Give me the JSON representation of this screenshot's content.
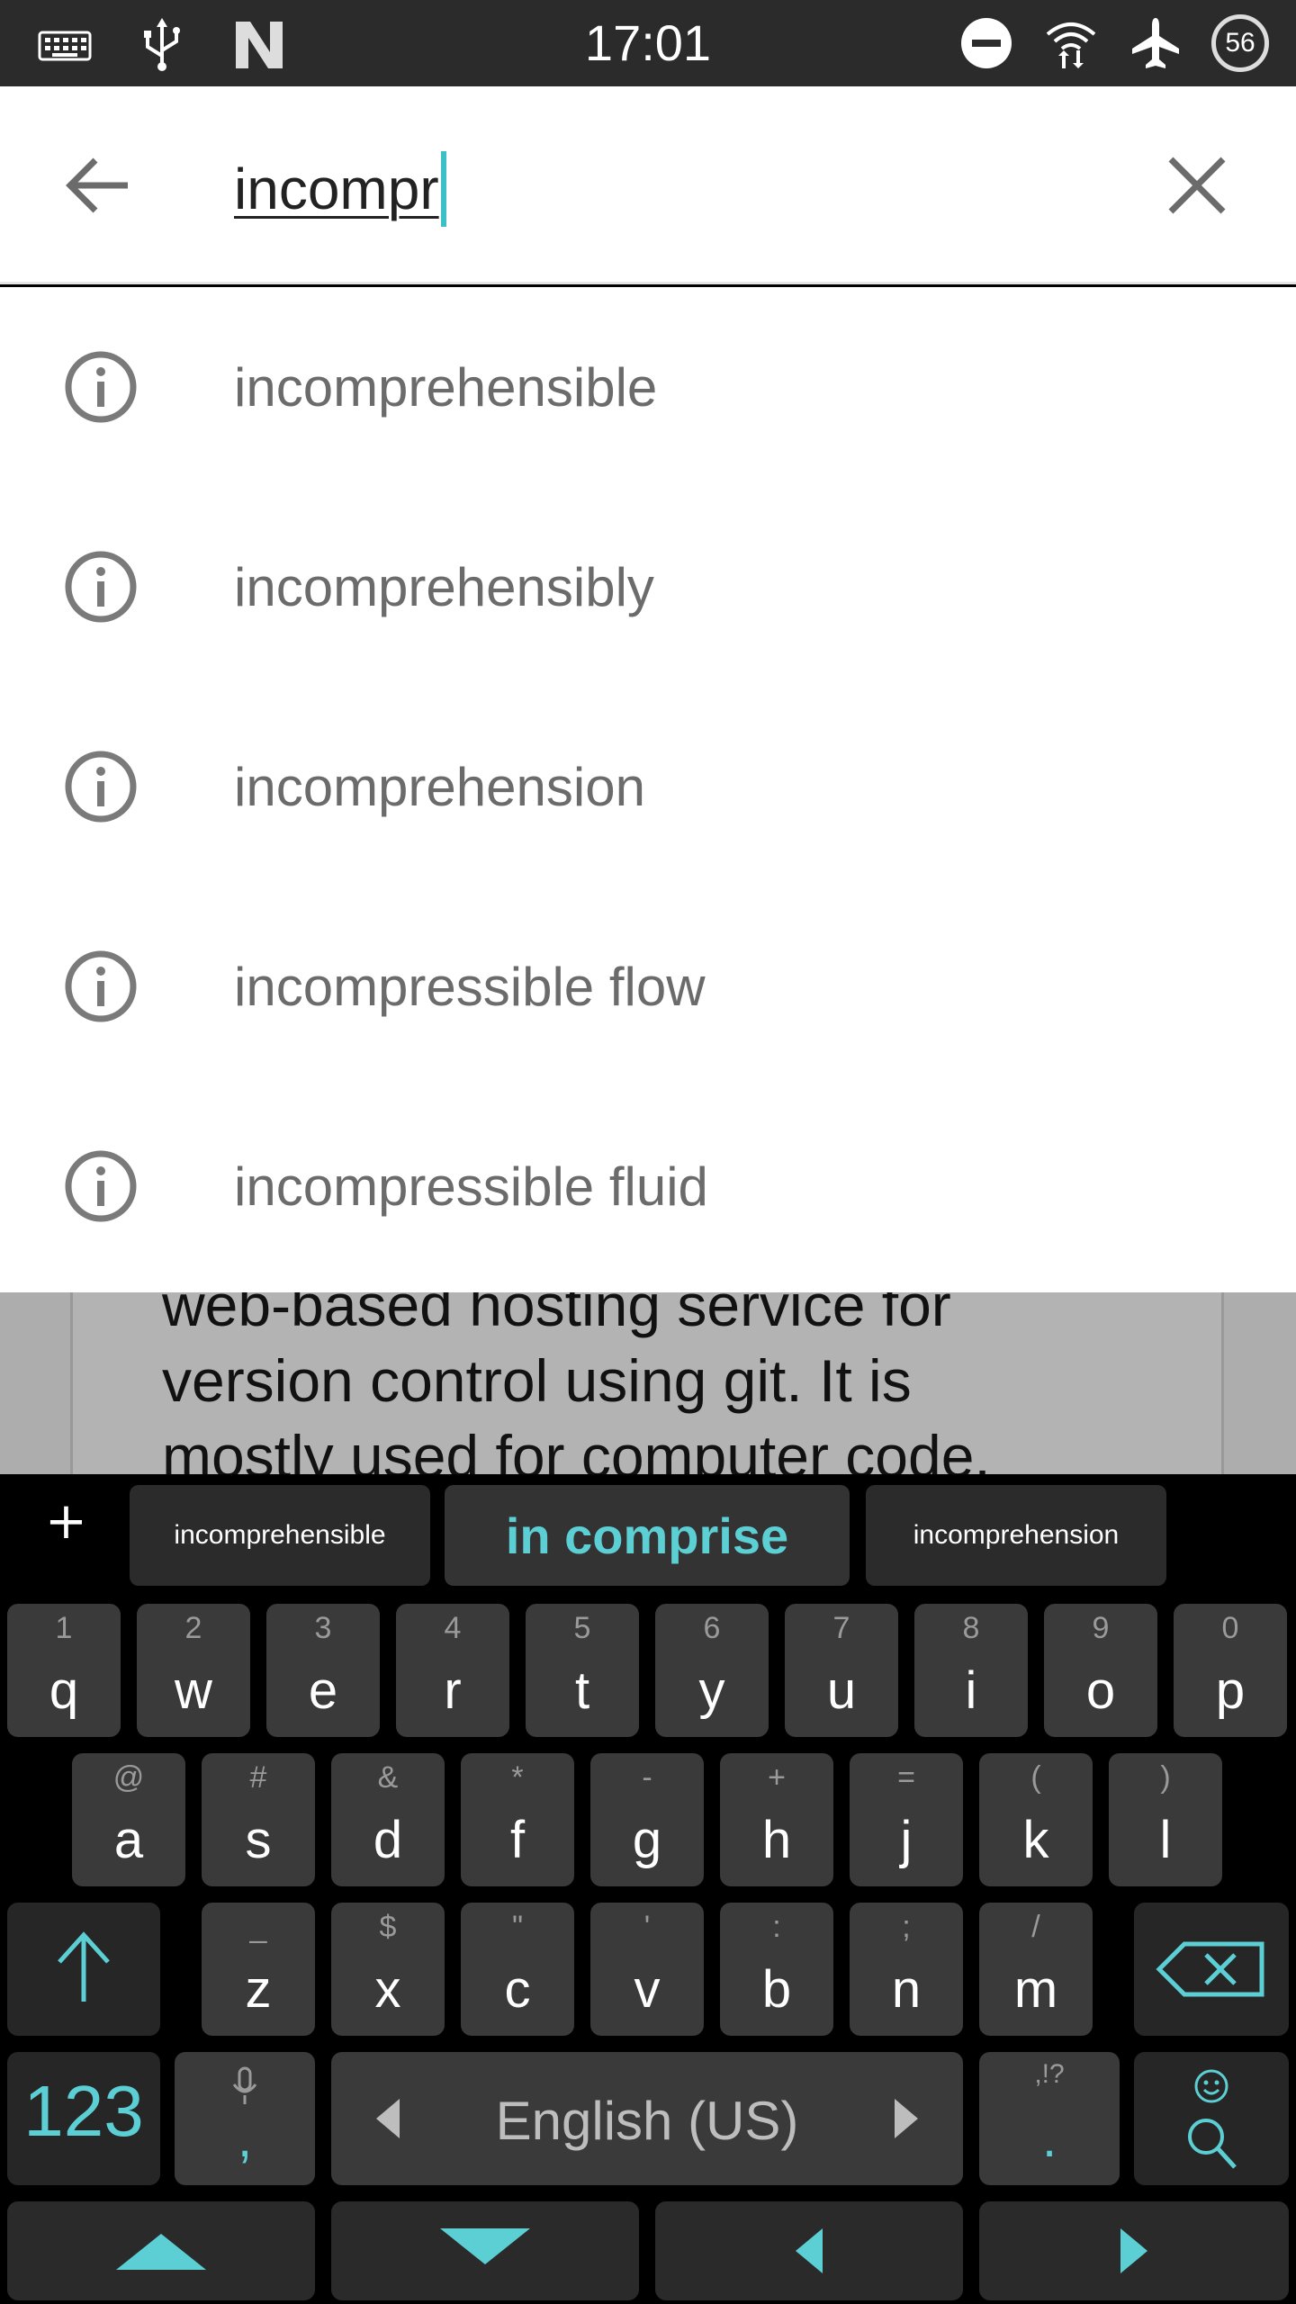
{
  "status_bar": {
    "time": "17:01",
    "battery": "56",
    "left_icons": [
      "keyboard-icon",
      "usb-icon",
      "n-notification-icon"
    ],
    "right_icons": [
      "do-not-disturb-icon",
      "wifi-icon",
      "airplane-mode-icon",
      "battery-icon"
    ]
  },
  "search": {
    "value": "incompr"
  },
  "suggestions": [
    "incomprehensible",
    "incomprehensibly",
    "incomprehension",
    "incompressible flow",
    "incompressible fluid"
  ],
  "background_text": [
    "web-based hosting service for",
    "version control using git. It is",
    "mostly used for computer code."
  ],
  "keyboard": {
    "suggest": {
      "left": "incomprehensible",
      "center": "in comprise",
      "right": "incomprehension",
      "plus": "+"
    },
    "row1": [
      {
        "hint": "1",
        "key": "q"
      },
      {
        "hint": "2",
        "key": "w"
      },
      {
        "hint": "3",
        "key": "e"
      },
      {
        "hint": "4",
        "key": "r"
      },
      {
        "hint": "5",
        "key": "t"
      },
      {
        "hint": "6",
        "key": "y"
      },
      {
        "hint": "7",
        "key": "u"
      },
      {
        "hint": "8",
        "key": "i"
      },
      {
        "hint": "9",
        "key": "o"
      },
      {
        "hint": "0",
        "key": "p"
      }
    ],
    "row2": [
      {
        "hint": "@",
        "key": "a"
      },
      {
        "hint": "#",
        "key": "s"
      },
      {
        "hint": "&",
        "key": "d"
      },
      {
        "hint": "*",
        "key": "f"
      },
      {
        "hint": "-",
        "key": "g"
      },
      {
        "hint": "+",
        "key": "h"
      },
      {
        "hint": "=",
        "key": "j"
      },
      {
        "hint": "(",
        "key": "k"
      },
      {
        "hint": ")",
        "key": "l"
      }
    ],
    "row3": [
      {
        "hint": "_",
        "key": "z"
      },
      {
        "hint": "$",
        "key": "x"
      },
      {
        "hint": "\"",
        "key": "c"
      },
      {
        "hint": "'",
        "key": "v"
      },
      {
        "hint": ":",
        "key": "b"
      },
      {
        "hint": ";",
        "key": "n"
      },
      {
        "hint": "/",
        "key": "m"
      }
    ],
    "num_key": "123",
    "comma_key": ",",
    "space_label": "English (US)",
    "period_hint": ",!?",
    "period_key": ".",
    "accent_color": "#5ccfd4"
  }
}
